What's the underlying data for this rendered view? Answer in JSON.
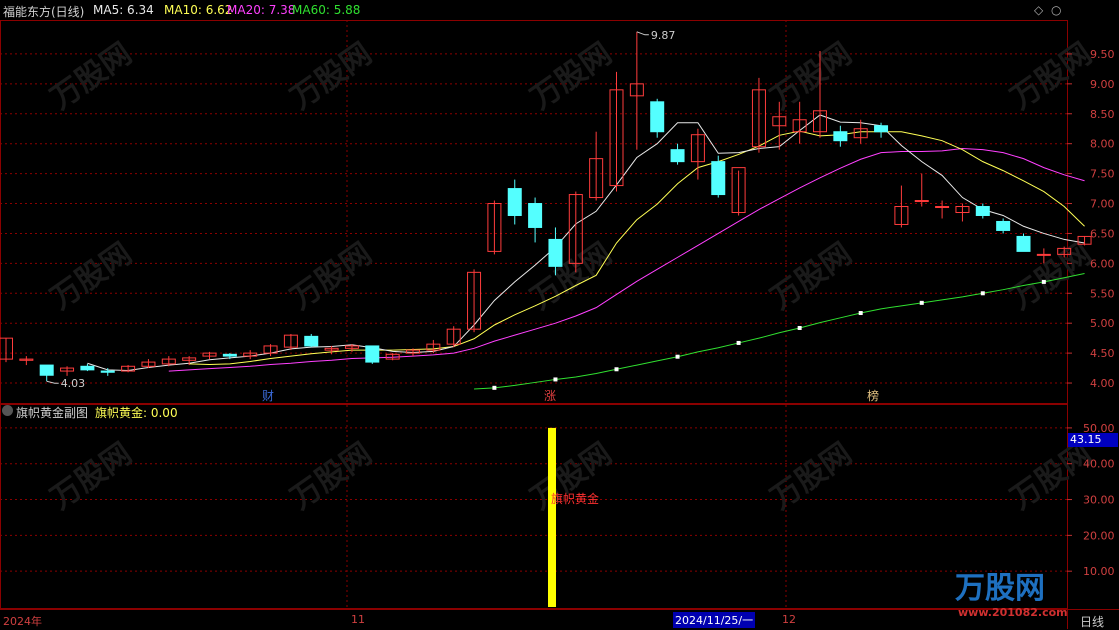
{
  "main_panel": {
    "title": "福能东方(日线)",
    "ma": [
      {
        "label": "MA5: 6.34",
        "color": "#e8e8e8"
      },
      {
        "label": "MA10: 6.62",
        "color": "#ffff55"
      },
      {
        "label": "MA20: 7.38",
        "color": "#ff40ff"
      },
      {
        "label": "MA60: 5.88",
        "color": "#30e030"
      }
    ],
    "high_label": "9.87",
    "low_label": "4.03",
    "event_markers": [
      "财",
      "涨",
      "榜"
    ],
    "price_axis": [
      "9.50",
      "9.00",
      "8.50",
      "8.00",
      "7.50",
      "7.00",
      "6.50",
      "6.00",
      "5.50",
      "5.00",
      "4.50",
      "4.00"
    ],
    "current_price_tag": "",
    "icons": [
      "diamond-icon",
      "circle-icon"
    ]
  },
  "sub_panel": {
    "title": "旗帜黄金副图",
    "indicator_label": "旗帜黄金: 0.00",
    "signal_label": "旗帜黄金",
    "axis": [
      "50.00",
      "40.00",
      "30.00",
      "20.00",
      "10.00"
    ],
    "current_value_tag": "43.15"
  },
  "time_axis": {
    "labels": [
      "2024年",
      "11",
      "2024/11/25/一",
      "12"
    ],
    "period_label": "日线"
  },
  "watermark": {
    "text": "万股网",
    "url": "www.201082.com"
  },
  "colors": {
    "up": "#ff3c3c",
    "down": "#54ffff",
    "grid": "#8b0000",
    "signal": "#ffff00"
  },
  "chart_data": {
    "type": "candlestick",
    "title": "福能东方(日线)",
    "ylim": [
      3.8,
      9.9
    ],
    "candles": [
      {
        "o": 4.4,
        "h": 4.75,
        "l": 4.35,
        "c": 4.75
      },
      {
        "o": 4.38,
        "h": 4.45,
        "l": 4.3,
        "c": 4.4
      },
      {
        "o": 4.3,
        "h": 4.3,
        "l": 4.03,
        "c": 4.13
      },
      {
        "o": 4.2,
        "h": 4.28,
        "l": 4.12,
        "c": 4.25
      },
      {
        "o": 4.28,
        "h": 4.32,
        "l": 4.2,
        "c": 4.22
      },
      {
        "o": 4.2,
        "h": 4.25,
        "l": 4.12,
        "c": 4.18
      },
      {
        "o": 4.2,
        "h": 4.3,
        "l": 4.18,
        "c": 4.28
      },
      {
        "o": 4.28,
        "h": 4.4,
        "l": 4.25,
        "c": 4.35
      },
      {
        "o": 4.32,
        "h": 4.45,
        "l": 4.28,
        "c": 4.4
      },
      {
        "o": 4.38,
        "h": 4.45,
        "l": 4.3,
        "c": 4.42
      },
      {
        "o": 4.45,
        "h": 4.52,
        "l": 4.4,
        "c": 4.5
      },
      {
        "o": 4.48,
        "h": 4.5,
        "l": 4.4,
        "c": 4.45
      },
      {
        "o": 4.45,
        "h": 4.55,
        "l": 4.4,
        "c": 4.5
      },
      {
        "o": 4.5,
        "h": 4.65,
        "l": 4.45,
        "c": 4.62
      },
      {
        "o": 4.6,
        "h": 4.82,
        "l": 4.55,
        "c": 4.8
      },
      {
        "o": 4.78,
        "h": 4.82,
        "l": 4.6,
        "c": 4.62
      },
      {
        "o": 4.55,
        "h": 4.62,
        "l": 4.48,
        "c": 4.58
      },
      {
        "o": 4.58,
        "h": 4.65,
        "l": 4.52,
        "c": 4.62
      },
      {
        "o": 4.62,
        "h": 4.62,
        "l": 4.32,
        "c": 4.35
      },
      {
        "o": 4.4,
        "h": 4.5,
        "l": 4.38,
        "c": 4.48
      },
      {
        "o": 4.5,
        "h": 4.58,
        "l": 4.45,
        "c": 4.55
      },
      {
        "o": 4.55,
        "h": 4.72,
        "l": 4.5,
        "c": 4.65
      },
      {
        "o": 4.65,
        "h": 4.95,
        "l": 4.6,
        "c": 4.9
      },
      {
        "o": 4.9,
        "h": 5.9,
        "l": 4.85,
        "c": 5.85
      },
      {
        "o": 6.2,
        "h": 7.05,
        "l": 6.15,
        "c": 7.0
      },
      {
        "o": 7.25,
        "h": 7.4,
        "l": 6.65,
        "c": 6.8
      },
      {
        "o": 7.0,
        "h": 7.1,
        "l": 6.35,
        "c": 6.6
      },
      {
        "o": 6.4,
        "h": 6.6,
        "l": 5.8,
        "c": 5.95
      },
      {
        "o": 6.0,
        "h": 7.2,
        "l": 5.85,
        "c": 7.15
      },
      {
        "o": 7.1,
        "h": 8.2,
        "l": 7.05,
        "c": 7.75
      },
      {
        "o": 7.3,
        "h": 9.2,
        "l": 7.2,
        "c": 8.9
      },
      {
        "o": 8.8,
        "h": 9.87,
        "l": 7.9,
        "c": 9.0
      },
      {
        "o": 8.7,
        "h": 8.75,
        "l": 8.1,
        "c": 8.2
      },
      {
        "o": 7.9,
        "h": 8.0,
        "l": 7.65,
        "c": 7.7
      },
      {
        "o": 7.7,
        "h": 8.25,
        "l": 7.4,
        "c": 8.15
      },
      {
        "o": 7.7,
        "h": 7.8,
        "l": 7.1,
        "c": 7.15
      },
      {
        "o": 6.85,
        "h": 7.55,
        "l": 6.8,
        "c": 7.6
      },
      {
        "o": 7.95,
        "h": 9.1,
        "l": 7.85,
        "c": 8.9
      },
      {
        "o": 8.3,
        "h": 8.7,
        "l": 7.9,
        "c": 8.45
      },
      {
        "o": 8.2,
        "h": 8.7,
        "l": 8.0,
        "c": 8.4
      },
      {
        "o": 8.2,
        "h": 9.55,
        "l": 8.1,
        "c": 8.55
      },
      {
        "o": 8.2,
        "h": 8.3,
        "l": 7.95,
        "c": 8.05
      },
      {
        "o": 8.1,
        "h": 8.4,
        "l": 8.0,
        "c": 8.25
      },
      {
        "o": 8.3,
        "h": 8.35,
        "l": 8.1,
        "c": 8.2
      },
      {
        "o": 6.65,
        "h": 7.3,
        "l": 6.6,
        "c": 6.95
      },
      {
        "o": 7.05,
        "h": 7.5,
        "l": 6.95,
        "c": 7.05
      },
      {
        "o": 6.95,
        "h": 7.05,
        "l": 6.75,
        "c": 6.95
      },
      {
        "o": 6.85,
        "h": 7.0,
        "l": 6.7,
        "c": 6.95
      },
      {
        "o": 6.95,
        "h": 7.0,
        "l": 6.75,
        "c": 6.8
      },
      {
        "o": 6.7,
        "h": 6.75,
        "l": 6.5,
        "c": 6.55
      },
      {
        "o": 6.45,
        "h": 6.5,
        "l": 6.2,
        "c": 6.2
      },
      {
        "o": 6.15,
        "h": 6.25,
        "l": 6.0,
        "c": 6.15
      },
      {
        "o": 6.15,
        "h": 6.28,
        "l": 6.1,
        "c": 6.25
      },
      {
        "o": 6.32,
        "h": 6.45,
        "l": 6.3,
        "c": 6.45
      }
    ],
    "ma5": [
      null,
      null,
      null,
      null,
      4.33,
      4.22,
      4.21,
      4.26,
      4.3,
      4.33,
      4.39,
      4.42,
      4.45,
      4.5,
      4.57,
      4.6,
      4.61,
      4.64,
      4.59,
      4.53,
      4.51,
      4.53,
      4.61,
      4.97,
      5.38,
      5.69,
      5.97,
      6.27,
      6.66,
      6.87,
      7.31,
      7.77,
      8.0,
      8.35,
      8.35,
      7.84,
      7.85,
      7.92,
      7.95,
      8.22,
      8.48,
      8.36,
      8.35,
      8.3,
      7.97,
      7.7,
      7.47,
      7.1,
      6.9,
      6.8,
      6.62,
      6.5,
      6.4,
      6.34
    ],
    "ma10": [
      null,
      null,
      null,
      null,
      null,
      null,
      null,
      null,
      null,
      4.32,
      4.31,
      4.32,
      4.36,
      4.41,
      4.45,
      4.49,
      4.52,
      4.55,
      4.55,
      4.55,
      4.56,
      4.57,
      4.61,
      4.74,
      4.97,
      5.14,
      5.29,
      5.45,
      5.63,
      5.8,
      6.34,
      6.73,
      6.99,
      7.33,
      7.6,
      7.7,
      7.82,
      7.96,
      8.14,
      8.21,
      8.13,
      8.15,
      8.2,
      8.2,
      8.2,
      8.13,
      8.05,
      7.9,
      7.7,
      7.55,
      7.38,
      7.2,
      6.95,
      6.62
    ],
    "ma20": [
      null,
      null,
      null,
      null,
      null,
      null,
      null,
      null,
      4.2,
      4.22,
      4.24,
      4.26,
      4.28,
      4.31,
      4.33,
      4.36,
      4.38,
      4.41,
      4.42,
      4.43,
      4.45,
      4.47,
      4.5,
      4.58,
      4.7,
      4.8,
      4.9,
      5.0,
      5.12,
      5.26,
      5.48,
      5.7,
      5.9,
      6.1,
      6.3,
      6.5,
      6.7,
      6.9,
      7.08,
      7.26,
      7.43,
      7.59,
      7.74,
      7.85,
      7.87,
      7.87,
      7.88,
      7.92,
      7.9,
      7.85,
      7.75,
      7.6,
      7.48,
      7.38
    ],
    "ma60": [
      null,
      null,
      null,
      null,
      null,
      null,
      null,
      null,
      null,
      null,
      null,
      null,
      null,
      null,
      null,
      null,
      null,
      null,
      null,
      null,
      null,
      null,
      null,
      3.9,
      3.92,
      3.96,
      4.01,
      4.06,
      4.1,
      4.16,
      4.23,
      4.3,
      4.37,
      4.44,
      4.52,
      4.59,
      4.67,
      4.75,
      4.84,
      4.92,
      5.01,
      5.09,
      5.17,
      5.24,
      5.29,
      5.34,
      5.39,
      5.44,
      5.5,
      5.56,
      5.63,
      5.69,
      5.76,
      5.83
    ],
    "signal": {
      "index": 27,
      "value": 50.0
    }
  }
}
